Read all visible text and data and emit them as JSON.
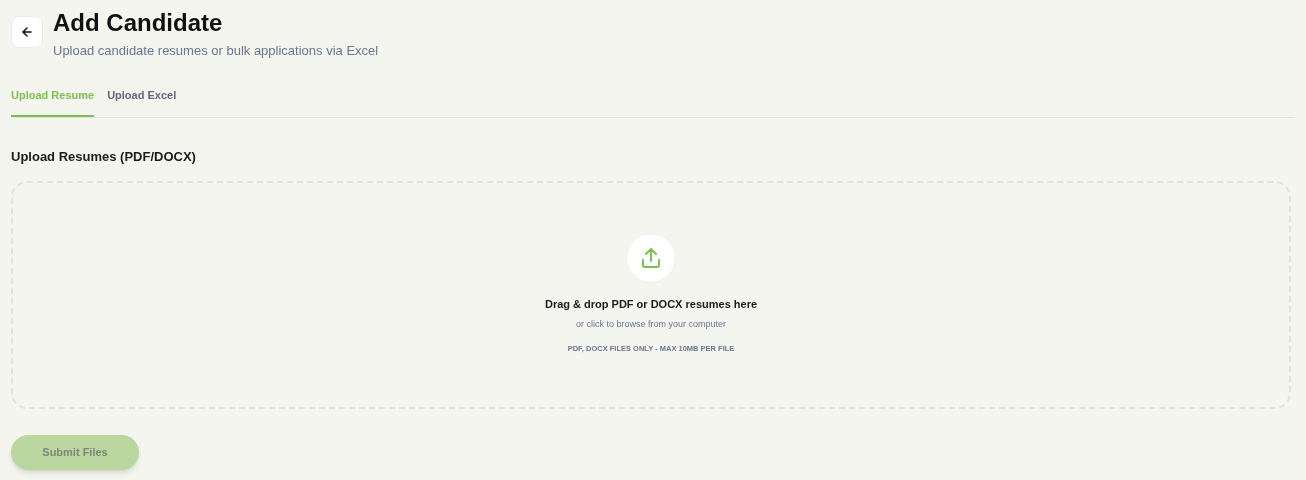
{
  "header": {
    "title": "Add Candidate",
    "subtitle": "Upload candidate resumes or bulk applications via Excel"
  },
  "tabs": [
    {
      "label": "Upload Resume",
      "selected": true
    },
    {
      "label": "Upload Excel",
      "selected": false
    }
  ],
  "section_label": "Upload Resumes (PDF/DOCX)",
  "dropzone": {
    "title": "Drag & drop PDF or DOCX resumes here",
    "hint": "or click to browse from your computer",
    "note": "PDF, DOCX FILES ONLY - MAX 10MB PER FILE"
  },
  "submit": {
    "label": "Submit Files",
    "disabled": true
  }
}
